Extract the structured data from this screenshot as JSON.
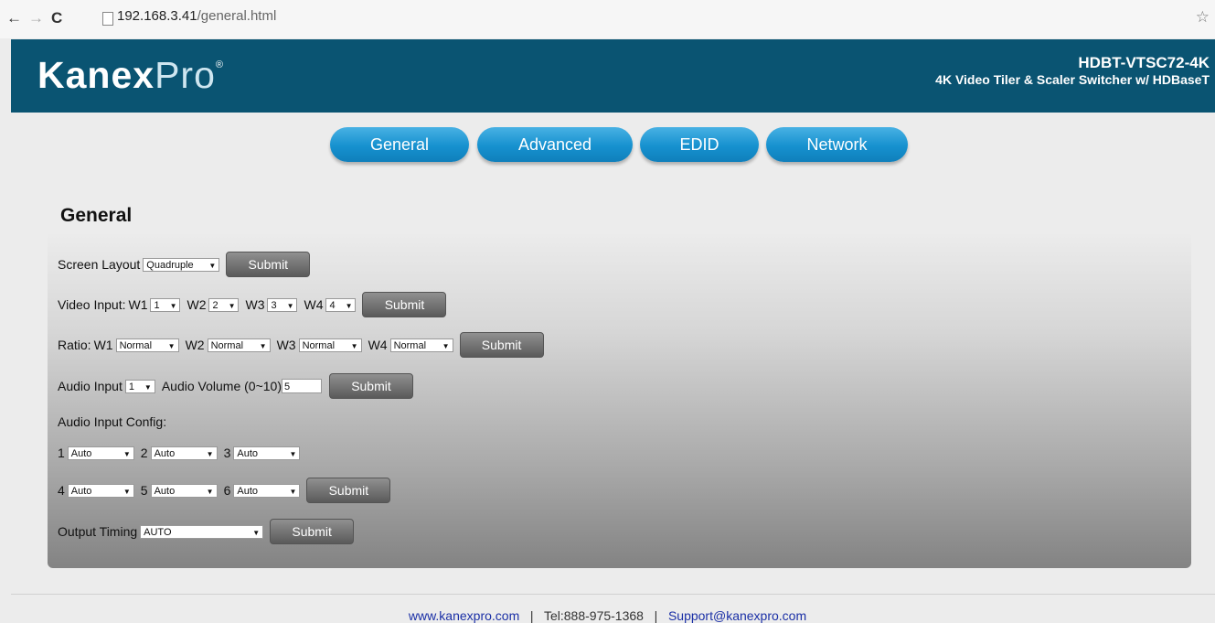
{
  "browser": {
    "back_icon": "←",
    "forward_icon": "→",
    "reload_icon": "C",
    "url_host": "192.168.3.41",
    "url_path": "/general.html",
    "star_icon": "☆"
  },
  "header": {
    "logo_bold": "Kanex",
    "logo_light": "Pro",
    "logo_mark": "®",
    "model": "HDBT-VTSC72-4K",
    "subtitle": "4K Video Tiler & Scaler Switcher w/ HDBaseT",
    "bg_color": "#0a5472"
  },
  "tabs": [
    "General",
    "Advanced",
    "EDID",
    "Network"
  ],
  "section_title": "General",
  "form": {
    "submit_label": "Submit",
    "screen_layout": {
      "label": "Screen Layout",
      "value": "Quadruple"
    },
    "video_input": {
      "label": "Video Input:",
      "items": [
        {
          "label": "W1",
          "value": "1"
        },
        {
          "label": "W2",
          "value": "2"
        },
        {
          "label": "W3",
          "value": "3"
        },
        {
          "label": "W4",
          "value": "4"
        }
      ]
    },
    "ratio": {
      "label": "Ratio:",
      "items": [
        {
          "label": "W1",
          "value": "Normal"
        },
        {
          "label": "W2",
          "value": "Normal"
        },
        {
          "label": "W3",
          "value": "Normal"
        },
        {
          "label": "W4",
          "value": "Normal"
        }
      ]
    },
    "audio": {
      "input_label": "Audio Input",
      "input_value": "1",
      "volume_label": "Audio Volume (0~10)",
      "volume_value": "5"
    },
    "audio_config": {
      "label": "Audio Input Config:",
      "items": [
        {
          "label": "1",
          "value": "Auto"
        },
        {
          "label": "2",
          "value": "Auto"
        },
        {
          "label": "3",
          "value": "Auto"
        },
        {
          "label": "4",
          "value": "Auto"
        },
        {
          "label": "5",
          "value": "Auto"
        },
        {
          "label": "6",
          "value": "Auto"
        }
      ]
    },
    "output_timing": {
      "label": "Output Timing",
      "value": "AUTO"
    }
  },
  "footer": {
    "website": "www.kanexpro.com",
    "sep": "|",
    "tel": "Tel:888-975-1368",
    "email": "Support@kanexpro.com"
  },
  "colors": {
    "tab": "#1691cf",
    "link": "#1a2fa6"
  }
}
